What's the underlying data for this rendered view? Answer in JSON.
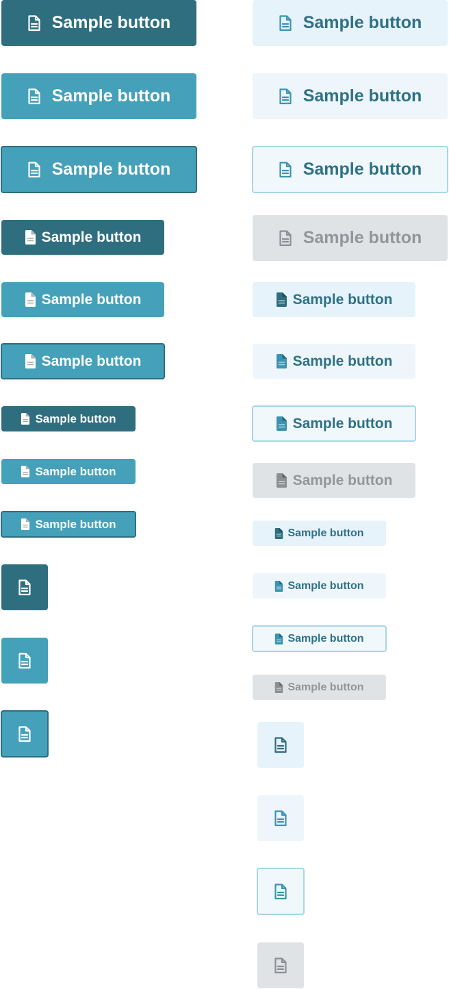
{
  "button_label": "Sample button",
  "icon": "document-icon",
  "colors": {
    "primary_dark": "#2e6e7f",
    "primary": "#45a0ba",
    "tint_light": "#e6f3fb",
    "tint_lighter": "#eef6fb",
    "tint_border": "#a9d5e6",
    "disabled_bg": "#dfe3e6",
    "disabled_text": "#939699",
    "tint_text": "#2f7186"
  }
}
